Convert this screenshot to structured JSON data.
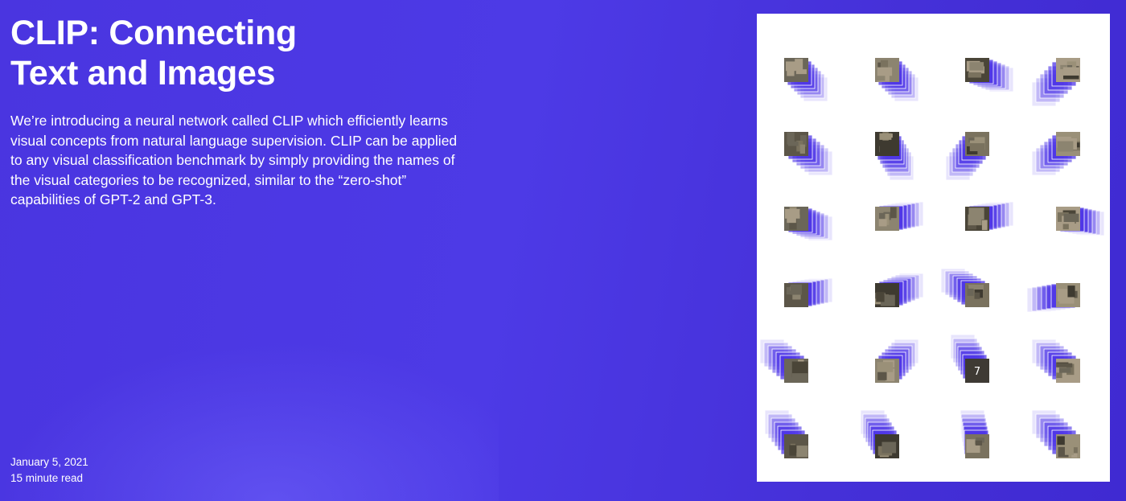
{
  "article": {
    "title": "CLIP: Connecting Text and Images",
    "description": "We’re introducing a neural network called CLIP which efficiently learns visual concepts from natural language supervision. CLIP can be applied to any visual classification benchmark by simply providing the names of the visual categories to be recognized, similar to the “zero-shot” capabilities of GPT-2 and GPT-3.",
    "date": "January 5, 2021",
    "read_time": "15 minute read"
  },
  "figure": {
    "tile_text": "7",
    "colors": {
      "accent": "#4b33e6",
      "card_fill": "#ffffff",
      "thumb_palette": [
        "#6b6658",
        "#8c8470",
        "#4a4538",
        "#a89c86",
        "#5c5648",
        "#3e3a30",
        "#7a725e",
        "#9a9078"
      ],
      "background_start": "#4a35e0",
      "background_end": "#3f2ad2"
    }
  }
}
